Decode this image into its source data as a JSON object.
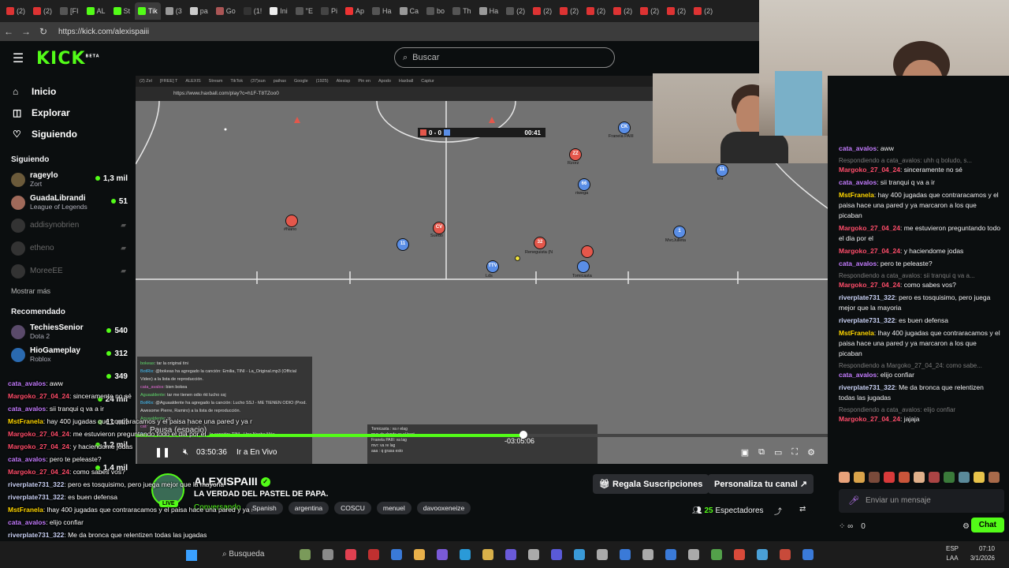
{
  "browser": {
    "tabs": [
      "(2)",
      "(2)",
      "[FI",
      "AL",
      "St",
      "Tik",
      "(3",
      "pa",
      "Go",
      "(1!",
      "Ini",
      "\"E",
      "Pi",
      "Ap",
      "Ha",
      "Ca",
      "bo",
      "Th",
      "Ha",
      "(2)",
      "(2)",
      "(2)",
      "(2)",
      "(2)",
      "(2)",
      "(2)",
      "(2)"
    ],
    "url": "https://kick.com/alexispaiii"
  },
  "header": {
    "logo": "KICK",
    "logo_badge": "BETA",
    "search_placeholder": "Buscar"
  },
  "sidebar": {
    "nav": [
      {
        "label": "Inicio",
        "icon": "home-icon"
      },
      {
        "label": "Explorar",
        "icon": "compass-icon"
      },
      {
        "label": "Siguiendo",
        "icon": "heart-icon"
      }
    ],
    "following_title": "Siguiendo",
    "following": [
      {
        "name": "rageylo",
        "game": "Zort",
        "viewers": "1,3 mil"
      },
      {
        "name": "GuadaLibrandi",
        "game": "League of Legends",
        "viewers": "51"
      }
    ],
    "offline": [
      "addisynobrien",
      "etheno",
      "MoreeEE"
    ],
    "show_more": "Mostrar más",
    "recommended_title": "Recomendado",
    "recommended": [
      {
        "name": "TechiesSenior",
        "game": "Dota 2",
        "viewers": "540"
      },
      {
        "name": "HioGameplay",
        "game": "Roblox",
        "viewers": "312"
      },
      {
        "name": "",
        "game": "",
        "viewers": "349"
      },
      {
        "name": "",
        "game": "",
        "viewers": "24 mil"
      },
      {
        "name": "",
        "game": "",
        "viewers": "11 mil"
      },
      {
        "name": "",
        "game": "",
        "viewers": "1,2 mil"
      },
      {
        "name": "",
        "game": "",
        "viewers": "1,4 mil"
      }
    ]
  },
  "video": {
    "inner_tabs": [
      "(2) Zel",
      "[FREE] T",
      "ALEXIS",
      "Stream",
      "TikTok",
      "(37)sun",
      "paihax",
      "Google",
      "(1925)",
      "Alexisp",
      "Pin en",
      "Apodo",
      "Haxball",
      "Captur"
    ],
    "inner_url": "https://www.haxball.com/play?c=h1F-T8TZoo0",
    "score": "0 - 0",
    "timer": "00:41",
    "players": [
      {
        "label": "CK",
        "name": "Franela PAIII",
        "team": "blue"
      },
      {
        "label": "ZZ",
        "name": "Rzorz",
        "team": "red"
      },
      {
        "label": "66",
        "name": "riwega",
        "team": "blue"
      },
      {
        "label": "11",
        "name": "imr",
        "team": "blue"
      },
      {
        "label": "",
        "name": "#Nano",
        "team": "red"
      },
      {
        "label": "CV",
        "name": "Suedo",
        "team": "red"
      },
      {
        "label": "11",
        "name": "",
        "team": "blue"
      },
      {
        "label": "32",
        "name": "Reneguista (N",
        "team": "red"
      },
      {
        "label": "1",
        "name": "MvcJulieta",
        "team": "blue"
      },
      {
        "label": "",
        "name": "",
        "team": "red"
      },
      {
        "label": "TTV",
        "name": "Lds",
        "team": "blue"
      },
      {
        "label": "",
        "name": "Tomicasta",
        "team": "blue"
      }
    ],
    "game_chat": [
      {
        "user": "bokeas",
        "text": ": tar la original tini"
      },
      {
        "user": "BotRix",
        "text": ": @bokeas ha agregado la canción: Emilia, TINI - La_Original.mp3 (Official Video) a la lista de reproducción."
      },
      {
        "user": "cata_avalos",
        "text": ": bien bokea"
      },
      {
        "user": "Aguaaldente",
        "text": ": tar me tienen odio rkt lucho ssj"
      },
      {
        "user": "BotRix",
        "text": ": @Aguaaldente ha agregado la canción: Lucho SSJ - ME TIENEN ODIO (Prod. Awesome Pierre, Ramiro) a la lista de reproducción."
      },
      {
        "user": "Aguaaldente",
        "text": ": :p"
      },
      {
        "user": "cata_avalos",
        "text": ": tar una noche mas tini"
      },
      {
        "user": "BotRix",
        "text": ": @cata_avalos ha agregado la canción: TINI - Una Noche Más"
      }
    ],
    "popup": [
      "Tomicasta : va r elag",
      "mvr: de donde es el host",
      "Franela PAIII: va lag",
      "mvr: va re lag",
      "aaa : q grasa esto"
    ],
    "seek_time": "-03:05:06",
    "tooltip": "Pausa (espacio)",
    "progress": 0.56,
    "current_time": "03:50:36",
    "go_live": "Ir a En Vivo"
  },
  "stream": {
    "streamer": "ALEXISPAIII",
    "live_label": "LIVE",
    "title": "LA VERDAD DEL PASTEL DE PAPA.",
    "category": "Conversando",
    "tags": [
      "Spanish",
      "argentina",
      "COSCU",
      "menuel",
      "davooxeneize"
    ],
    "gift_button": "Regala Suscripciones",
    "customize_button": "Personaliza tu canal",
    "viewer_count": "25",
    "viewer_label": "Espectadores"
  },
  "chat": {
    "messages": [
      {
        "type": "msg",
        "user": "cata_avalos",
        "cls": "u-cata",
        "text": ": aww"
      },
      {
        "type": "reply",
        "text": "Respondiendo a cata_avalos: uhh q boludo, s..."
      },
      {
        "type": "msg",
        "user": "Margoko_27_04_24",
        "cls": "u-marg",
        "text": ": sinceramente no sé"
      },
      {
        "type": "msg",
        "user": "cata_avalos",
        "cls": "u-cata",
        "text": ": sii tranqui q va a ir"
      },
      {
        "type": "msg",
        "user": "MstFranela",
        "cls": "u-mst",
        "text": ": hay 400 jugadas que contraracamos y el paisa hace una pared y ya marcaron a los que picaban"
      },
      {
        "type": "msg",
        "user": "Margoko_27_04_24",
        "cls": "u-marg",
        "text": ": me estuvieron preguntando todo el dia por el"
      },
      {
        "type": "msg",
        "user": "Margoko_27_04_24",
        "cls": "u-marg",
        "text": ": y haciendome jodas"
      },
      {
        "type": "msg",
        "user": "cata_avalos",
        "cls": "u-cata",
        "text": ": pero te peleaste?"
      },
      {
        "type": "reply",
        "text": "Respondiendo a cata_avalos: sii tranqui q va a..."
      },
      {
        "type": "msg",
        "user": "Margoko_27_04_24",
        "cls": "u-marg",
        "text": ": como sabes vos?"
      },
      {
        "type": "msg",
        "user": "riverplate731_322",
        "cls": "u-river",
        "text": ": pero es tosquisimo, pero juega mejor que la mayoria"
      },
      {
        "type": "msg",
        "user": "riverplate731_322",
        "cls": "u-river",
        "text": ": es buen defensa"
      },
      {
        "type": "msg",
        "user": "MstFranela",
        "cls": "u-mst",
        "text": ": lhay 400 jugadas que contraracamos y el paisa hace una pared y ya marcaron a los que picaban"
      },
      {
        "type": "reply",
        "text": "Respondiendo a Margoko_27_04_24: como sabe..."
      },
      {
        "type": "msg",
        "user": "cata_avalos",
        "cls": "u-cata",
        "text": ": elijo confiar"
      },
      {
        "type": "msg",
        "user": "riverplate731_322",
        "cls": "u-river",
        "text": ": Me da bronca que relentizen todas las jugadas"
      },
      {
        "type": "reply",
        "text": "Respondiendo a cata_avalos: elijo confiar"
      },
      {
        "type": "msg",
        "user": "Margoko_27_04_24",
        "cls": "u-marg",
        "text": ": jajaja"
      }
    ],
    "input_placeholder": "Enviar un mensaje",
    "points": "0",
    "chat_button": "Chat"
  },
  "overlay_chat": [
    {
      "user": "cata_avalos",
      "text": ": aww",
      "cls": "u-cata"
    },
    {
      "user": "Margoko_27_04_24",
      "text": ": sinceramente no sé",
      "cls": "u-marg"
    },
    {
      "user": "cata_avalos",
      "text": ": sii tranqui q va a ir",
      "cls": "u-cata"
    },
    {
      "user": "MstFranela",
      "text": ": hay 400 jugadas que contraracamos y el paisa hace una pared y ya marcaron a los que picaban",
      "cls": "u-mst"
    },
    {
      "user": "Margoko_27_04_24",
      "text": ": me estuvieron preguntando todo el dia por el",
      "cls": "u-marg"
    },
    {
      "user": "Margoko_27_04_24",
      "text": ": y haciendome jodas",
      "cls": "u-marg"
    },
    {
      "user": "cata_avalos",
      "text": ": pero te peleaste?",
      "cls": "u-cata"
    },
    {
      "user": "Margoko_27_04_24",
      "text": ": como sabes vos?",
      "cls": "u-marg"
    },
    {
      "user": "riverplate731_322",
      "text": ": pero es tosquisimo, pero juega mejor que la mayoria",
      "cls": "u-river"
    },
    {
      "user": "riverplate731_322",
      "text": ": es buen defensa",
      "cls": "u-river"
    },
    {
      "user": "MstFranela",
      "text": ": lhay 400 jugadas que contraracamos y el paisa hace una pared y ya marcaron a los que picaban",
      "cls": "u-mst"
    },
    {
      "user": "cata_avalos",
      "text": ": elijo confiar",
      "cls": "u-cata"
    },
    {
      "user": "riverplate731_322",
      "text": ": Me da bronca que relentizen todas las jugadas",
      "cls": "u-river"
    },
    {
      "user": "Margoko_27_04_24",
      "text": ": jajaja",
      "cls": "u-marg"
    }
  ],
  "taskbar": {
    "search_label": "Busqueda",
    "lang": "ESP",
    "lang2": "LAA",
    "time": "07:10",
    "date": "3/1/2026"
  }
}
